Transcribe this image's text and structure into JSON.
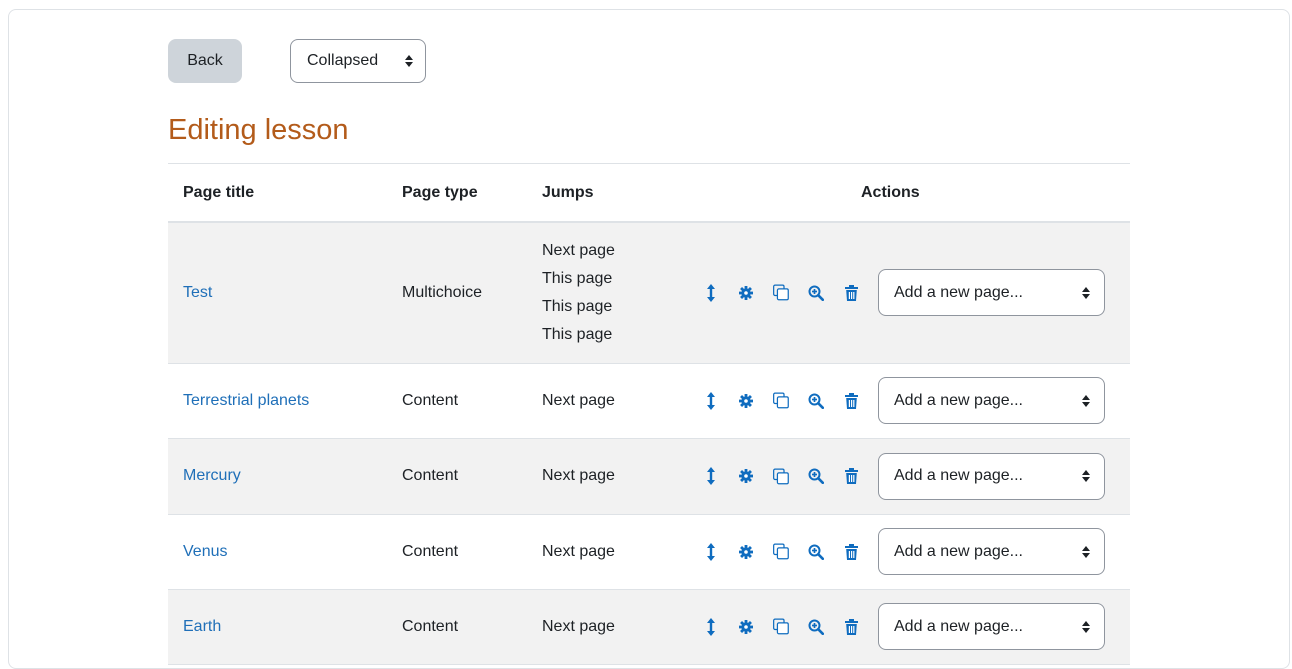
{
  "toolbar": {
    "back_label": "Back",
    "view_select_value": "Collapsed"
  },
  "page_title": "Editing lesson",
  "table": {
    "headers": [
      "Page title",
      "Page type",
      "Jumps",
      "Actions"
    ],
    "rows": [
      {
        "title": "Test",
        "type": "Multichoice",
        "jumps": [
          "Next page",
          "This page",
          "This page",
          "This page"
        ],
        "add_placeholder": "Add a new page..."
      },
      {
        "title": "Terrestrial planets",
        "type": "Content",
        "jumps": [
          "Next page"
        ],
        "add_placeholder": "Add a new page..."
      },
      {
        "title": "Mercury",
        "type": "Content",
        "jumps": [
          "Next page"
        ],
        "add_placeholder": "Add a new page..."
      },
      {
        "title": "Venus",
        "type": "Content",
        "jumps": [
          "Next page"
        ],
        "add_placeholder": "Add a new page..."
      },
      {
        "title": "Earth",
        "type": "Content",
        "jumps": [
          "Next page"
        ],
        "add_placeholder": "Add a new page..."
      }
    ]
  },
  "icons": {
    "move": "move-icon",
    "edit": "gear-icon",
    "duplicate": "copy-icon",
    "preview": "zoom-in-icon",
    "delete": "trash-icon"
  },
  "colors": {
    "title": "#b35b1a",
    "link": "#1f6fb8",
    "icon": "#0f6cbf",
    "row_stripe": "#f2f2f2"
  }
}
